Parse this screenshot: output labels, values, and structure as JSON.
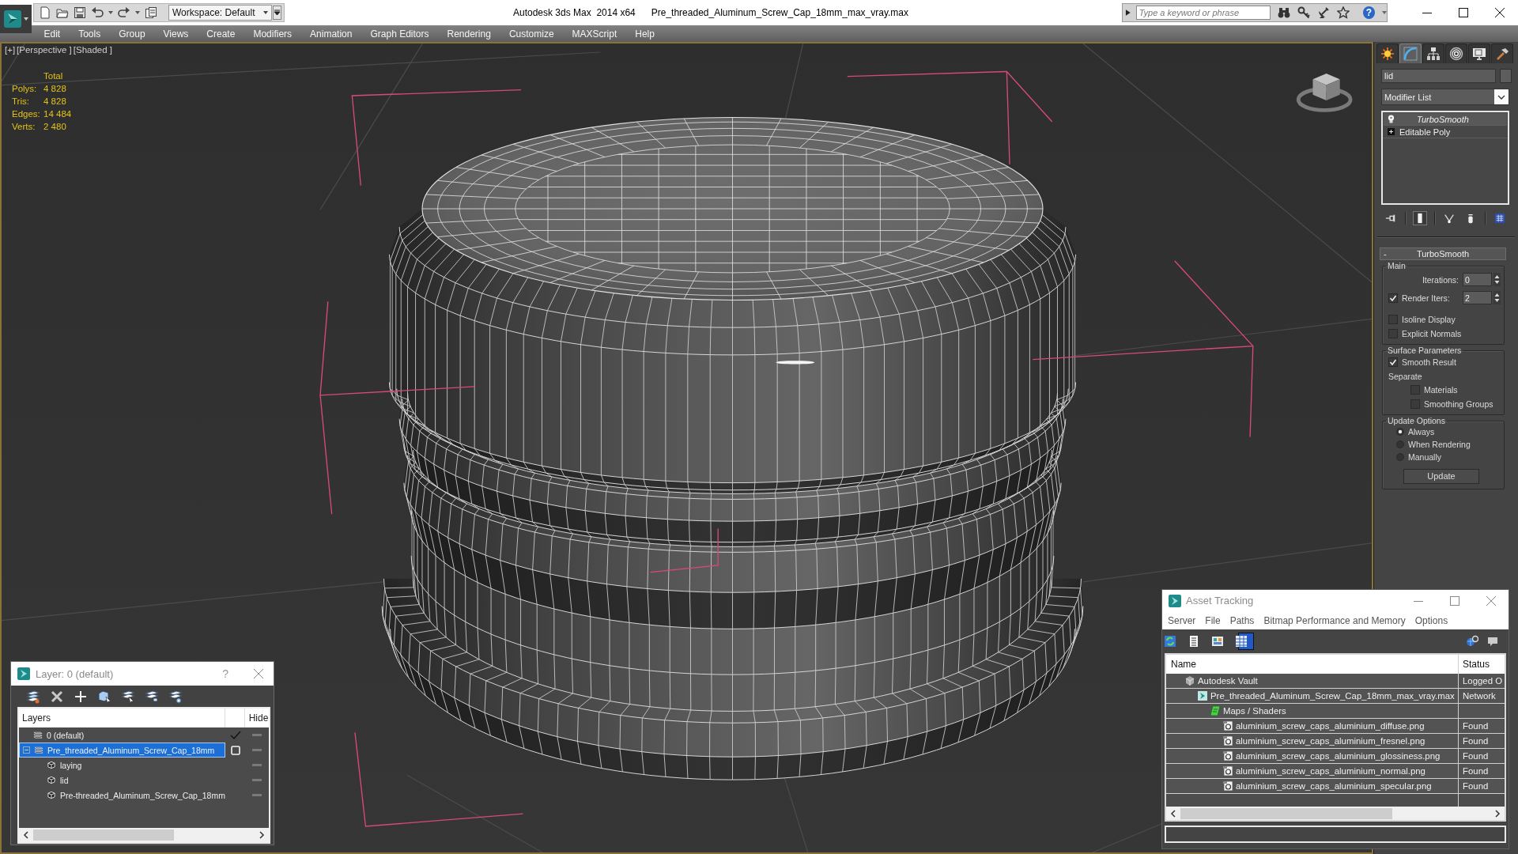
{
  "title_bar": {
    "workspace": "Workspace: Default",
    "app_title": "Autodesk 3ds Max  2014 x64",
    "file_name": "Pre_threaded_Aluminum_Screw_Cap_18mm_max_vray.max",
    "search": {
      "placeholder": "Type a keyword or phrase"
    },
    "help": "?"
  },
  "menu": [
    "Edit",
    "Tools",
    "Group",
    "Views",
    "Create",
    "Modifiers",
    "Animation",
    "Graph Editors",
    "Rendering",
    "Customize",
    "MAXScript",
    "Help"
  ],
  "viewport": {
    "labels": [
      "[+]",
      "[Perspective ]",
      "[Shaded ]"
    ],
    "stats": {
      "header": "Total",
      "rows": [
        {
          "label": "Polys:",
          "value": "4 828"
        },
        {
          "label": "Tris:",
          "value": "4 828"
        },
        {
          "label": "Edges:",
          "value": "14 484"
        },
        {
          "label": "Verts:",
          "value": "2 480"
        }
      ]
    }
  },
  "command_panel": {
    "tabs": [
      {
        "kind": "create",
        "selected": false
      },
      {
        "kind": "modify",
        "selected": true
      },
      {
        "kind": "hierarchy",
        "selected": false
      },
      {
        "kind": "motion",
        "selected": false
      },
      {
        "kind": "display",
        "selected": false
      },
      {
        "kind": "utilities",
        "selected": false
      }
    ],
    "object_name": "lid",
    "modifier_list": "Modifier List",
    "stack": [
      {
        "kind": "modifier",
        "name": "TurboSmooth",
        "selected": true
      },
      {
        "kind": "base",
        "name": "Editable Poly",
        "selected": false
      }
    ],
    "stack_tools": [
      {
        "kind": "pin",
        "selected": false
      },
      {
        "kind": "end_result",
        "selected": true
      },
      {
        "kind": "make_unique",
        "selected": false
      },
      {
        "kind": "remove",
        "selected": false
      },
      {
        "kind": "configure",
        "selected": false
      }
    ],
    "rollout": {
      "collapse": "-",
      "title": "TurboSmooth",
      "groups": [
        {
          "title": "Main",
          "items": [
            {
              "kind": "spinner",
              "label": "Iterations:",
              "value": "0"
            },
            {
              "kind": "check_spinner",
              "label": "Render Iters:",
              "value": "2",
              "checked": true
            },
            {
              "kind": "checkbox",
              "label": "Isoline Display",
              "checked": false
            },
            {
              "kind": "checkbox",
              "label": "Explicit Normals",
              "checked": false
            }
          ]
        },
        {
          "title": "Surface Parameters",
          "items": [
            {
              "kind": "checkbox",
              "label": "Smooth Result",
              "checked": true
            },
            {
              "kind": "label",
              "label": "Separate",
              "children": [
                {
                  "kind": "checkbox",
                  "label": "Materials",
                  "checked": false
                },
                {
                  "kind": "checkbox",
                  "label": "Smoothing Groups",
                  "checked": false
                }
              ]
            }
          ]
        },
        {
          "title": "Update Options",
          "items": [
            {
              "kind": "radio",
              "label": "Always",
              "selected": true
            },
            {
              "kind": "radio",
              "label": "When Rendering",
              "selected": false
            },
            {
              "kind": "radio",
              "label": "Manually",
              "selected": false
            },
            {
              "kind": "button",
              "label": "Update"
            }
          ]
        }
      ]
    }
  },
  "layer_dialog": {
    "title": "Layer: 0 (default)",
    "help": "?",
    "columns": [
      "Layers",
      "Hide"
    ],
    "layers": [
      {
        "kind": "layer",
        "name": "0 (default)",
        "current": true,
        "selected": false
      },
      {
        "kind": "layer",
        "name": "Pre_threaded_Aluminum_Screw_Cap_18mm",
        "current": false,
        "selected": true,
        "expanded": true,
        "children": [
          {
            "kind": "object",
            "name": "laying",
            "selected": false
          },
          {
            "kind": "object",
            "name": "lid",
            "selected": false
          },
          {
            "kind": "object",
            "name": "Pre-threaded_Aluminum_Screw_Cap_18mm",
            "selected": false
          }
        ]
      }
    ]
  },
  "asset_tracking": {
    "title": "Asset Tracking",
    "menu": [
      "Server",
      "File",
      "Paths",
      "Bitmap Performance and Memory",
      "Options"
    ],
    "tools": [
      {
        "kind": "refresh",
        "selected": false
      },
      {
        "kind": "list",
        "selected": false
      },
      {
        "kind": "thumbnails",
        "selected": false
      },
      {
        "kind": "table",
        "selected": true
      }
    ],
    "columns": [
      "Name",
      "Status"
    ],
    "tree": [
      {
        "kind": "vault",
        "name": "Autodesk Vault",
        "status": "Logged O",
        "children": [
          {
            "kind": "max_file",
            "name": "Pre_threaded_Aluminum_Screw_Cap_18mm_max_vray.max",
            "status": "Network",
            "children": [
              {
                "kind": "folder",
                "name": "Maps / Shaders",
                "children": [
                  {
                    "kind": "image",
                    "name": "aluminium_screw_caps_aluminium_diffuse.png",
                    "status": "Found"
                  },
                  {
                    "kind": "image",
                    "name": "aluminium_screw_caps_aluminium_fresnel.png",
                    "status": "Found"
                  },
                  {
                    "kind": "image",
                    "name": "aluminium_screw_caps_aluminium_glossiness.png",
                    "status": "Found"
                  },
                  {
                    "kind": "image",
                    "name": "aluminium_screw_caps_aluminium_normal.png",
                    "status": "Found"
                  },
                  {
                    "kind": "image",
                    "name": "aluminium_screw_caps_aluminium_specular.png",
                    "status": "Found"
                  }
                ]
              }
            ]
          }
        ]
      }
    ]
  }
}
